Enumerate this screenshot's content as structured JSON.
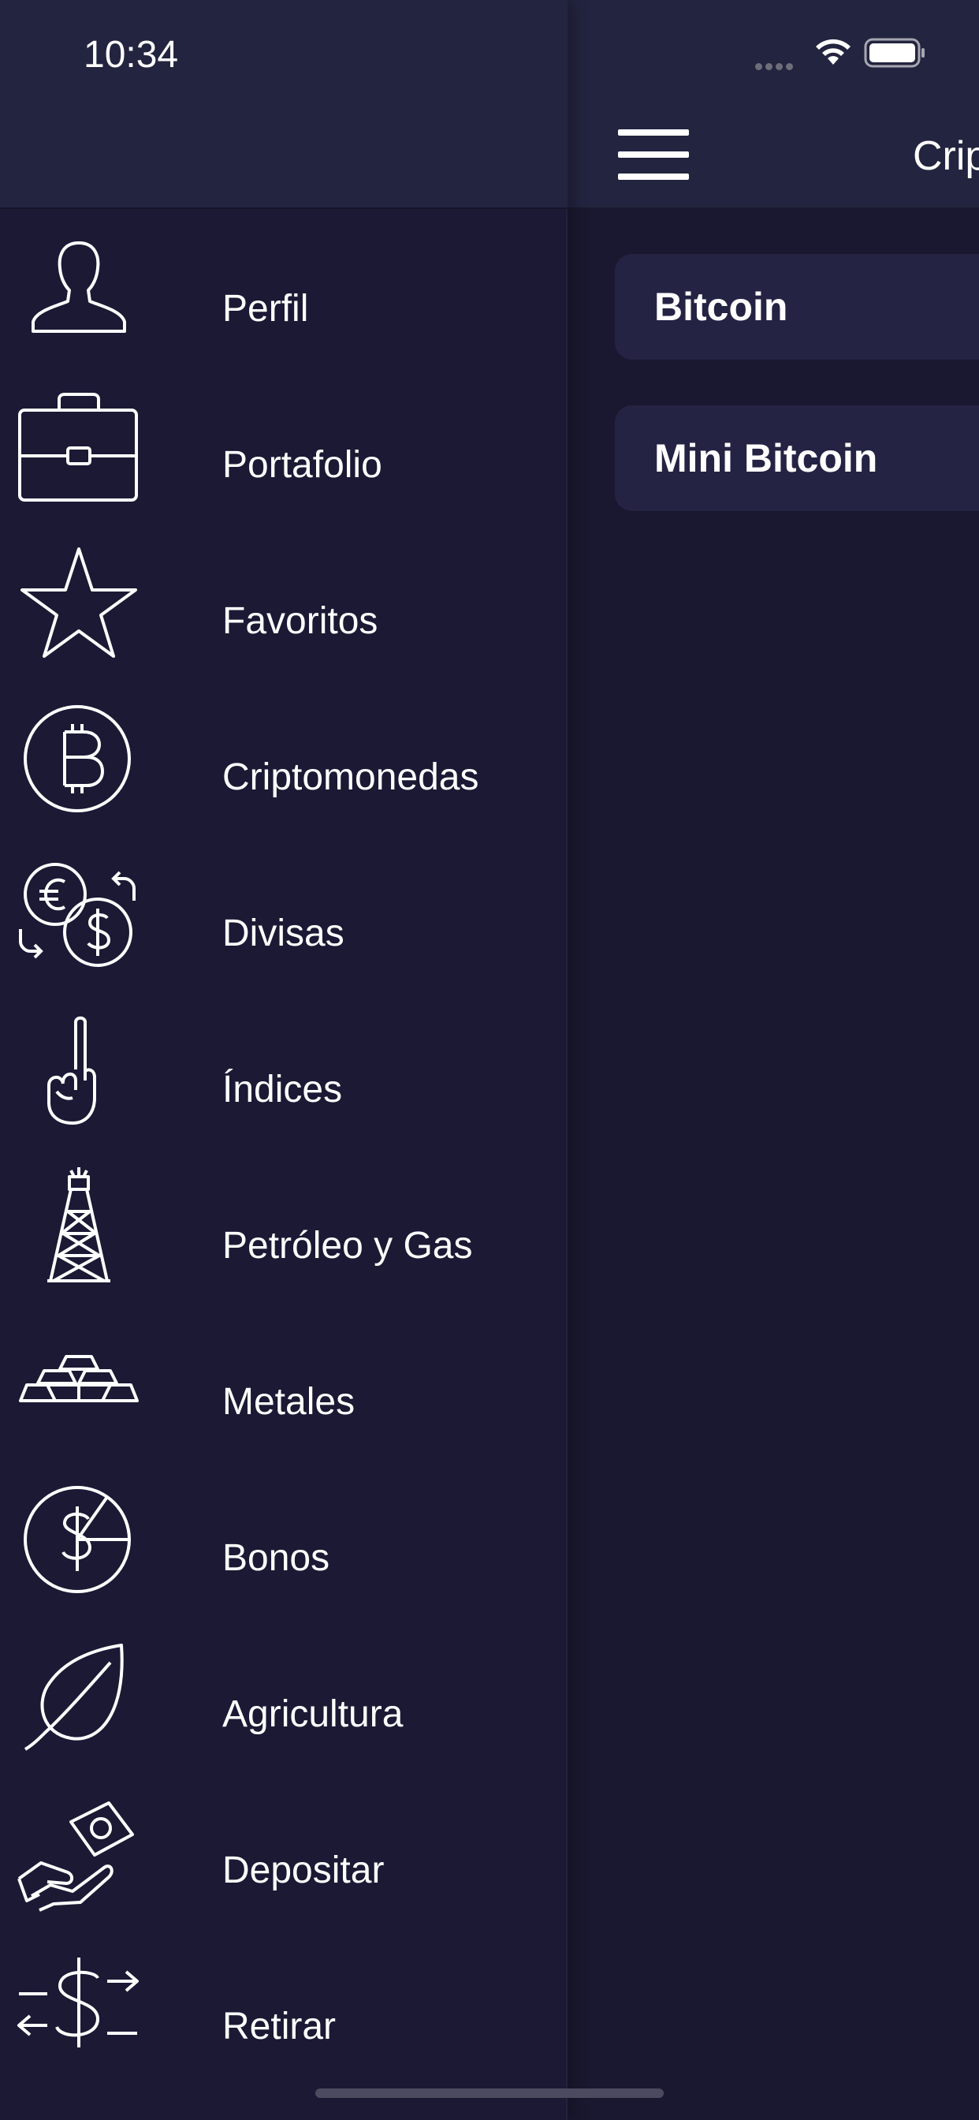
{
  "status_bar": {
    "time": "10:34"
  },
  "main": {
    "title": "Crip",
    "items": [
      {
        "label": "Bitcoin"
      },
      {
        "label": "Mini Bitcoin"
      }
    ]
  },
  "drawer": {
    "items": [
      {
        "label": "Perfil",
        "icon": "user-icon"
      },
      {
        "label": "Portafolio",
        "icon": "briefcase-icon"
      },
      {
        "label": "Favoritos",
        "icon": "star-icon"
      },
      {
        "label": "Criptomonedas",
        "icon": "bitcoin-icon"
      },
      {
        "label": "Divisas",
        "icon": "currency-exchange-icon"
      },
      {
        "label": "Índices",
        "icon": "index-finger-icon"
      },
      {
        "label": "Petróleo y Gas",
        "icon": "oil-rig-icon"
      },
      {
        "label": "Metales",
        "icon": "gold-bars-icon"
      },
      {
        "label": "Bonos",
        "icon": "bond-icon"
      },
      {
        "label": "Agricultura",
        "icon": "leaf-icon"
      },
      {
        "label": "Depositar",
        "icon": "deposit-hand-icon"
      },
      {
        "label": "Retirar",
        "icon": "withdraw-dollar-icon"
      }
    ]
  },
  "colors": {
    "background": "#1b1934",
    "header": "#23243f",
    "card": "#252344",
    "text": "#ffffff"
  }
}
